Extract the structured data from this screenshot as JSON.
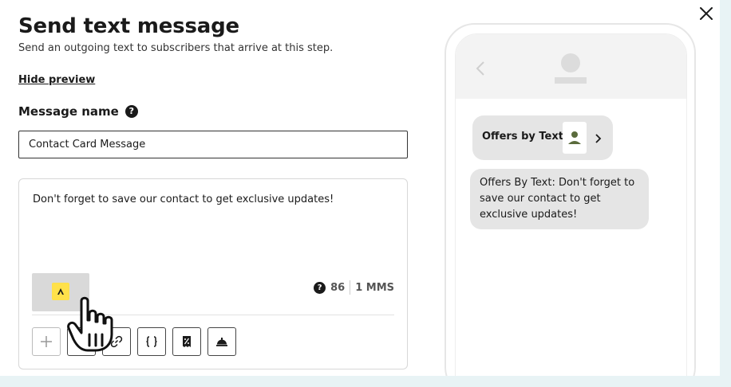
{
  "dialog": {
    "title": "Send text message",
    "subtitle": "Send an outgoing text to subscribers that arrive at this step.",
    "hide_preview_label": "Hide preview",
    "close_icon": "close-icon"
  },
  "message_name": {
    "label": "Message name",
    "help_icon": "question-circle-icon",
    "value": "Contact Card Message"
  },
  "editor": {
    "body": "Don't forget to save our contact to get exclusive updates!",
    "attachment_icon": "contact-card-logo",
    "character_count": "86",
    "message_type": "1 MMS",
    "toolbar": [
      {
        "name": "add-button",
        "glyph": "+"
      },
      {
        "name": "emoji-button",
        "glyph": ""
      },
      {
        "name": "link-button",
        "glyph": ""
      },
      {
        "name": "variables-button",
        "glyph": "{}"
      },
      {
        "name": "discount-button",
        "glyph": ""
      },
      {
        "name": "concierge-button",
        "glyph": ""
      }
    ]
  },
  "preview": {
    "contact_card_name": "Offers by Text",
    "bubble_text": "Offers By Text: Don't forget to save our contact to get exclusive updates!"
  },
  "colors": {
    "accent_yellow": "#ffe14a",
    "bubble_gray": "#e5e5e5",
    "avatar_green": "#5a6b3c"
  }
}
